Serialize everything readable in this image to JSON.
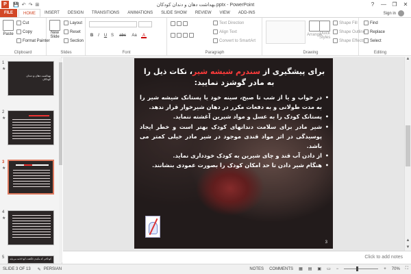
{
  "window": {
    "title": "بهداشت دهان و دندان کودکان.pptx - PowerPoint",
    "help": "?",
    "minimize": "—",
    "restore": "❐",
    "close": "✕"
  },
  "quick_access": [
    "💾",
    "↶",
    "↷",
    "⊞"
  ],
  "tabs": [
    "FILE",
    "HOME",
    "INSERT",
    "DESIGN",
    "TRANSITIONS",
    "ANIMATIONS",
    "SLIDE SHOW",
    "REVIEW",
    "VIEW",
    "ADD-INS"
  ],
  "active_tab": "HOME",
  "signin": "Sign in",
  "ribbon": {
    "clipboard": {
      "paste": "Paste",
      "cut": "Cut",
      "copy": "Copy",
      "format_painter": "Format Painter",
      "label": "Clipboard"
    },
    "slides": {
      "new_slide": "New",
      "new_slide2": "Slide",
      "layout": "Layout",
      "reset": "Reset",
      "section": "Section",
      "label": "Slides"
    },
    "font": {
      "label": "Font",
      "bold": "B",
      "italic": "I",
      "underline": "U",
      "shadow": "S",
      "strike": "abc",
      "case": "Aa",
      "color": "A"
    },
    "paragraph": {
      "text_direction": "Text Direction",
      "align_text": "Align Text",
      "smartart": "Convert to SmartArt",
      "label": "Paragraph"
    },
    "drawing": {
      "arrange": "Arrange",
      "quick_styles": "Quick",
      "quick_styles2": "Styles",
      "shape_fill": "Shape Fill",
      "shape_outline": "Shape Outline",
      "shape_effects": "Shape Effects",
      "label": "Drawing"
    },
    "editing": {
      "find": "Find",
      "replace": "Replace",
      "select": "Select",
      "label": "Editing"
    }
  },
  "thumbnails": [
    {
      "num": "1",
      "star": "★"
    },
    {
      "num": "2",
      "star": "★"
    },
    {
      "num": "3",
      "star": "★"
    },
    {
      "num": "4",
      "star": "★"
    },
    {
      "num": "5",
      "star": ""
    }
  ],
  "thumb1_caption": "بهداشت دهان و دندان کودکان",
  "thumb5_caption": "کودکانی که مکیدن انگشت آنها ادامه می‌یابد، در معرض",
  "slide": {
    "title_prefix": "برای پیشگیری از ",
    "title_highlight": "سندرم شیشه شیر",
    "title_suffix": "، نکات ذیل را به مادر گوشزد نمایید:",
    "bullets": [
      "در خواب و یا از شب تا صبح، سینه خود یا پستانک شیشه شیر را به مدت طولانی و به دفعات مکرر در دهان شیرخوار قرار ندهد.",
      "پستانک کودک را به عسل و مواد شیرین آغشته ننماید.",
      "شیر مادر برای سلامت دندانهای کودک بهتر است و خطر ایجاد پوسیدگی در اثر مواد قندی موجود در شیر مادر خیلی کمتر می باشد.",
      "از دادن آب قند و چای شیرین به کودک خودداری نماید.",
      "هنگام شیر دادن تا حد امکان کودک را بصورت عمودی بنشانند."
    ],
    "number": "3"
  },
  "notes_placeholder": "Click to add notes",
  "status": {
    "slide": "SLIDE 3 OF 13",
    "language": "PERSIAN",
    "notes": "NOTES",
    "comments": "COMMENTS",
    "zoom": "70%"
  },
  "colors": {
    "accent": "#d24726",
    "highlight": "#ff3b3b"
  },
  "icons": [
    "save-icon",
    "undo-icon",
    "redo-icon",
    "paste-icon",
    "cut-icon",
    "copy-icon",
    "format-painter-icon",
    "find-icon",
    "replace-icon",
    "tooth-logo"
  ]
}
